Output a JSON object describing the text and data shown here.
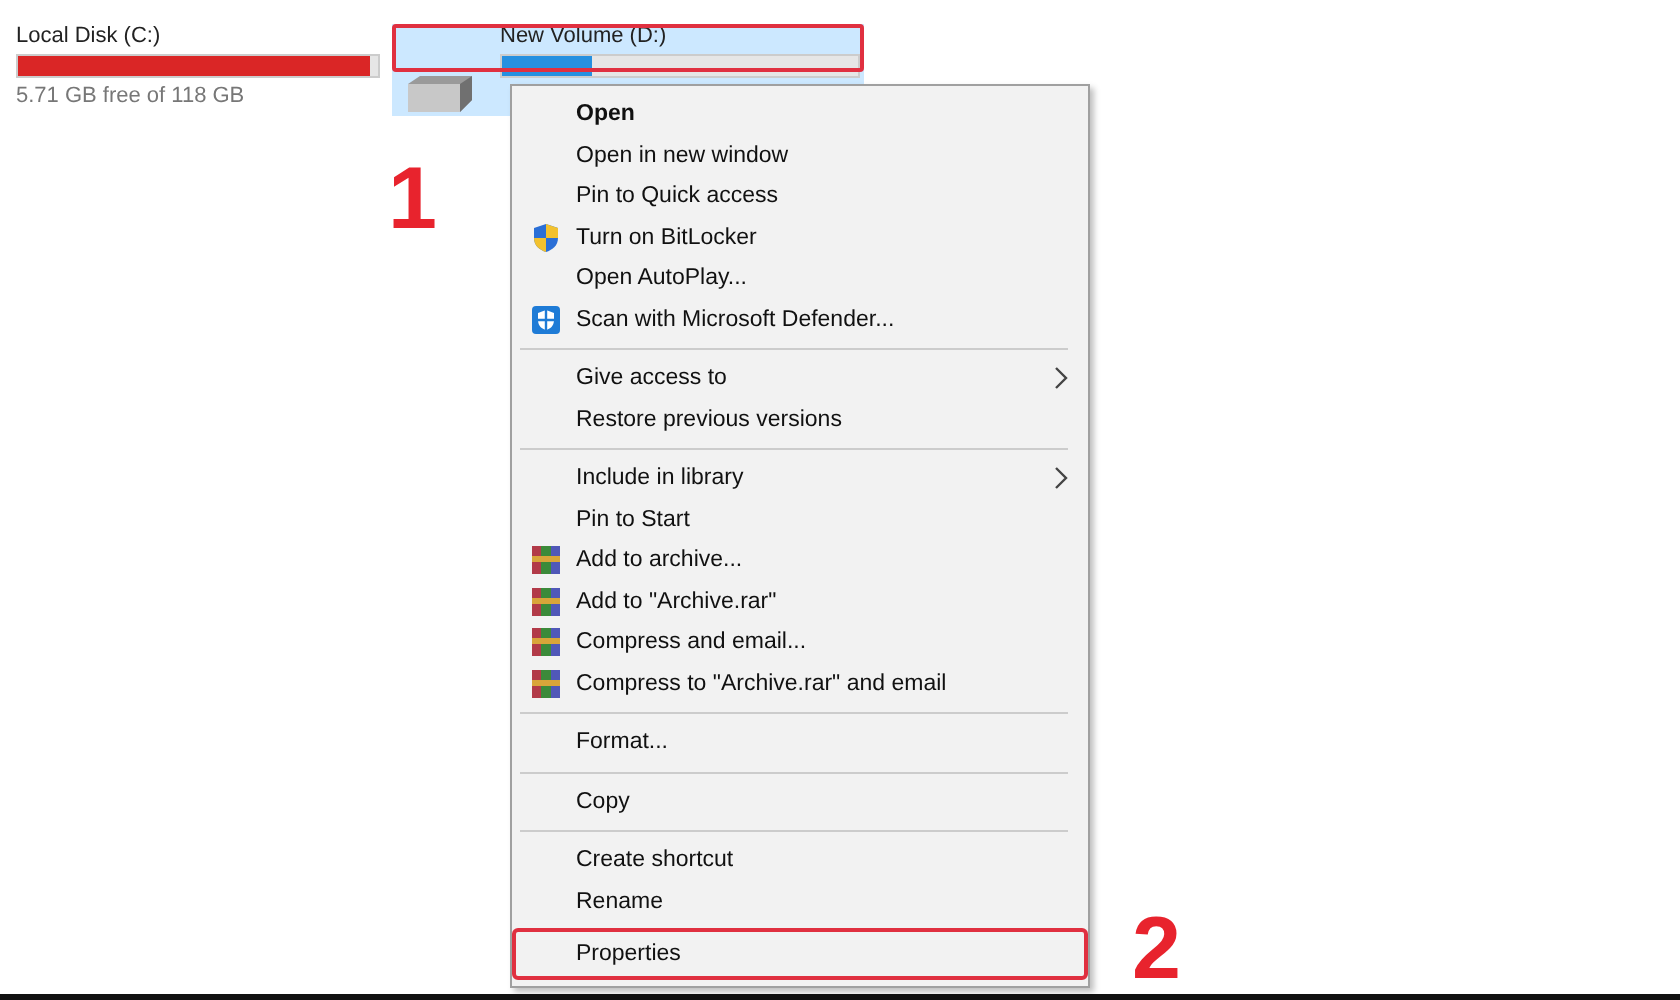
{
  "drives": [
    {
      "name": "Local Disk (C:)",
      "level": 0.975,
      "low_space": true,
      "free_text": "5.71 GB free of 118 GB",
      "selected": false
    },
    {
      "name": "New Volume (D:)",
      "level": 0.25,
      "low_space": false,
      "selected": true
    }
  ],
  "context_menu": {
    "items": [
      {
        "kind": "item",
        "label": "Open",
        "default": true
      },
      {
        "kind": "item",
        "label": "Open in new window"
      },
      {
        "kind": "item",
        "label": "Pin to Quick access"
      },
      {
        "kind": "bitlocker",
        "label": "Turn on BitLocker"
      },
      {
        "kind": "item",
        "label": "Open AutoPlay..."
      },
      {
        "kind": "defender",
        "label": "Scan with Microsoft Defender..."
      },
      {
        "kind": "separator"
      },
      {
        "kind": "item",
        "label": "Give access to",
        "submenu": true
      },
      {
        "kind": "item",
        "label": "Restore previous versions"
      },
      {
        "kind": "separator"
      },
      {
        "kind": "item",
        "label": "Include in library",
        "submenu": true
      },
      {
        "kind": "item",
        "label": "Pin to Start"
      },
      {
        "kind": "archive",
        "label": "Add to archive..."
      },
      {
        "kind": "archive",
        "label": "Add to \"Archive.rar\""
      },
      {
        "kind": "archive",
        "label": "Compress and email..."
      },
      {
        "kind": "archive",
        "label": "Compress to \"Archive.rar\" and email"
      },
      {
        "kind": "separator"
      },
      {
        "kind": "item",
        "label": "Format..."
      },
      {
        "kind": "separator"
      },
      {
        "kind": "item",
        "label": "Copy"
      },
      {
        "kind": "separator"
      },
      {
        "kind": "item",
        "label": "Create shortcut"
      },
      {
        "kind": "item",
        "label": "Rename"
      },
      {
        "kind": "item",
        "label": "Properties",
        "highlighted": true
      }
    ]
  },
  "annotations": [
    {
      "label": "1"
    },
    {
      "label": "2"
    }
  ]
}
